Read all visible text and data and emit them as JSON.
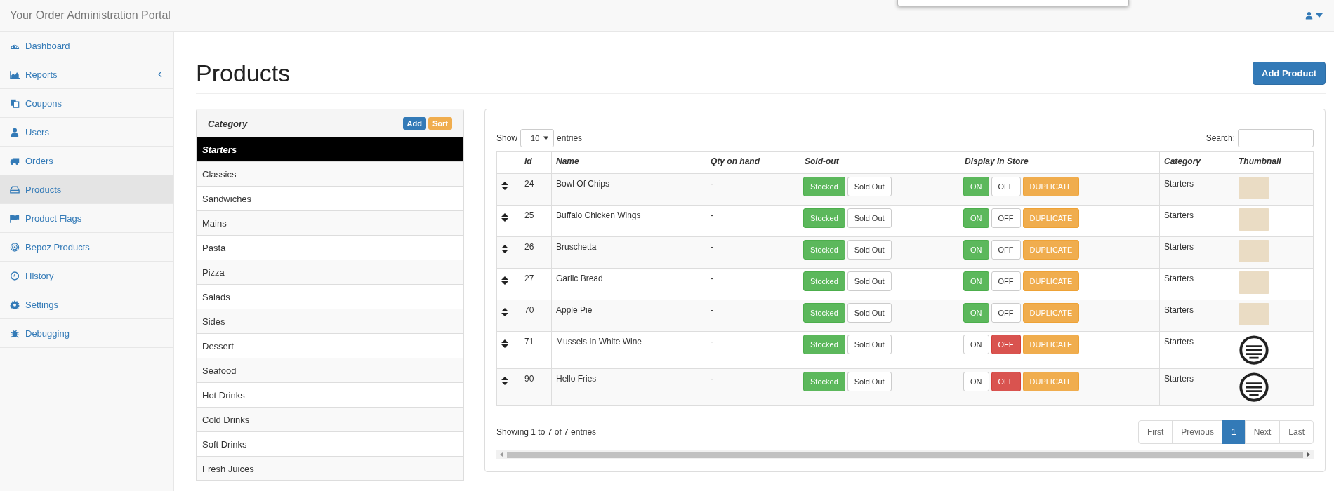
{
  "navbar": {
    "title": "Your Order Administration Portal"
  },
  "sidebar": {
    "items": [
      {
        "label": "Dashboard",
        "kind": "link",
        "selected": false
      },
      {
        "label": "Reports",
        "kind": "submenu",
        "selected": false
      },
      {
        "label": "Coupons",
        "kind": "link",
        "selected": false
      },
      {
        "label": "Users",
        "kind": "link",
        "selected": false
      },
      {
        "label": "Orders",
        "kind": "link",
        "selected": false
      },
      {
        "label": "Products",
        "kind": "link",
        "selected": true
      },
      {
        "label": "Product Flags",
        "kind": "link",
        "selected": false
      },
      {
        "label": "Bepoz Products",
        "kind": "link",
        "selected": false
      },
      {
        "label": "History",
        "kind": "link",
        "selected": false
      },
      {
        "label": "Settings",
        "kind": "link",
        "selected": false
      },
      {
        "label": "Debugging",
        "kind": "link",
        "selected": false
      }
    ]
  },
  "page": {
    "title": "Products",
    "add_button": "Add Product"
  },
  "category": {
    "title": "Category",
    "buttons": [
      {
        "label": "Add",
        "kind": "primary"
      },
      {
        "label": "Sort",
        "kind": "warning"
      }
    ],
    "items": [
      {
        "label": "Starters",
        "selected": true
      },
      {
        "label": "Classics",
        "selected": false
      },
      {
        "label": "Sandwiches",
        "selected": false
      },
      {
        "label": "Mains",
        "selected": false
      },
      {
        "label": "Pasta",
        "selected": false
      },
      {
        "label": "Pizza",
        "selected": false
      },
      {
        "label": "Salads",
        "selected": false
      },
      {
        "label": "Sides",
        "selected": false
      },
      {
        "label": "Dessert",
        "selected": false
      },
      {
        "label": "Seafood",
        "selected": false
      },
      {
        "label": "Hot Drinks",
        "selected": false
      },
      {
        "label": "Cold Drinks",
        "selected": false
      },
      {
        "label": "Soft Drinks",
        "selected": false
      },
      {
        "label": "Fresh Juices",
        "selected": false
      }
    ]
  },
  "table": {
    "show_label": "Show",
    "page_size": "10",
    "entries_label": "entries",
    "search_label": "Search:",
    "columns": [
      "Id",
      "Name",
      "Qty on hand",
      "Sold-out",
      "Display in Store",
      "Category",
      "Thumbnail"
    ],
    "rows": [
      {
        "id": "24",
        "name": "Bowl Of Chips",
        "qty": "-",
        "stocked_label": "Stocked",
        "sold_out_label": "Sold Out",
        "sold_out": false,
        "on_label": "ON",
        "off_label": "OFF",
        "display_on": true,
        "duplicate_label": "DUPLICATE",
        "category": "Starters",
        "thumbnail": {
          "kind": "photo"
        }
      },
      {
        "id": "25",
        "name": "Buffalo Chicken Wings",
        "qty": "-",
        "stocked_label": "Stocked",
        "sold_out_label": "Sold Out",
        "sold_out": false,
        "on_label": "ON",
        "off_label": "OFF",
        "display_on": true,
        "duplicate_label": "DUPLICATE",
        "category": "Starters",
        "thumbnail": {
          "kind": "photo"
        }
      },
      {
        "id": "26",
        "name": "Bruschetta",
        "qty": "-",
        "stocked_label": "Stocked",
        "sold_out_label": "Sold Out",
        "sold_out": false,
        "on_label": "ON",
        "off_label": "OFF",
        "display_on": true,
        "duplicate_label": "DUPLICATE",
        "category": "Starters",
        "thumbnail": {
          "kind": "photo"
        }
      },
      {
        "id": "27",
        "name": "Garlic Bread",
        "qty": "-",
        "stocked_label": "Stocked",
        "sold_out_label": "Sold Out",
        "sold_out": false,
        "on_label": "ON",
        "off_label": "OFF",
        "display_on": true,
        "duplicate_label": "DUPLICATE",
        "category": "Starters",
        "thumbnail": {
          "kind": "photo"
        }
      },
      {
        "id": "70",
        "name": "Apple Pie",
        "qty": "-",
        "stocked_label": "Stocked",
        "sold_out_label": "Sold Out",
        "sold_out": false,
        "on_label": "ON",
        "off_label": "OFF",
        "display_on": true,
        "duplicate_label": "DUPLICATE",
        "category": "Starters",
        "thumbnail": {
          "kind": "photo"
        }
      },
      {
        "id": "71",
        "name": "Mussels In White Wine",
        "qty": "-",
        "stocked_label": "Stocked",
        "sold_out_label": "Sold Out",
        "sold_out": false,
        "on_label": "ON",
        "off_label": "OFF",
        "display_on": false,
        "duplicate_label": "DUPLICATE",
        "category": "Starters",
        "thumbnail": {
          "kind": "logo"
        }
      },
      {
        "id": "90",
        "name": "Hello Fries",
        "qty": "-",
        "stocked_label": "Stocked",
        "sold_out_label": "Sold Out",
        "sold_out": false,
        "on_label": "ON",
        "off_label": "OFF",
        "display_on": false,
        "duplicate_label": "DUPLICATE",
        "category": "Starters",
        "thumbnail": {
          "kind": "logo"
        }
      }
    ],
    "info": "Showing 1 to 7 of 7 entries",
    "pagination": [
      {
        "label": "First",
        "selected": false
      },
      {
        "label": "Previous",
        "selected": false
      },
      {
        "label": "1",
        "selected": true
      },
      {
        "label": "Next",
        "selected": false
      },
      {
        "label": "Last",
        "selected": false
      }
    ]
  }
}
